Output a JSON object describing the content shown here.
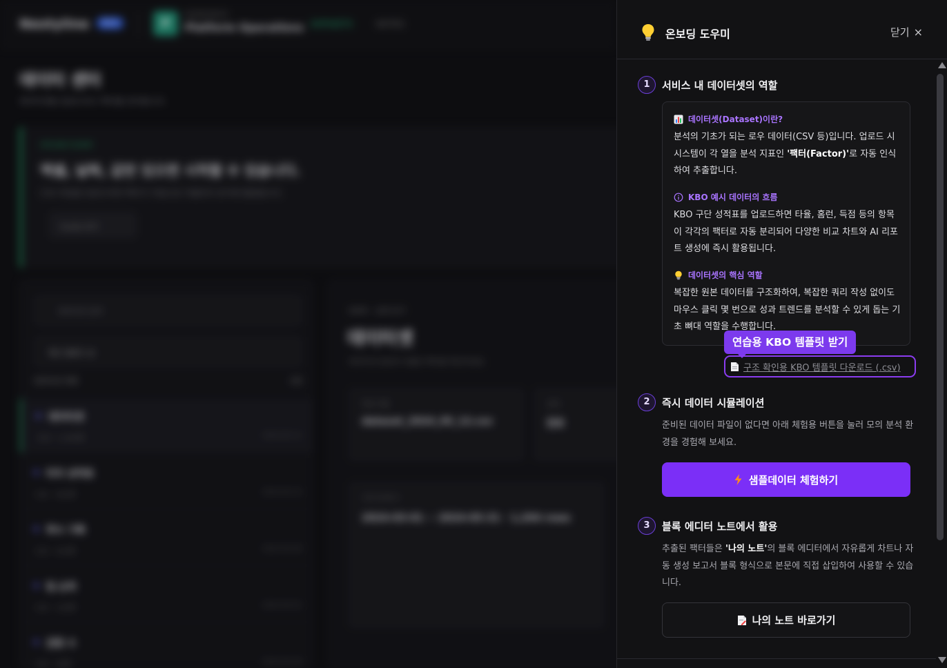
{
  "background": {
    "logo": "Nestyline",
    "beta": "Beta",
    "workspace_sub": "WORKSPACE",
    "workspace_name": "Platform Operations",
    "workspace_initial": "P",
    "nav_active": "DATASETS",
    "nav_other": "NOTES",
    "page_title": "데이터 센터",
    "page_subtitle": "데이터셋을 업로드하고 팩터를 관리합니다.",
    "banner_tag": "UPLOAD GUIDE",
    "banner_title": "엑셀, 날짜, 값만 있으면 시작할 수 있습니다.",
    "banner_desc": "CSV 파일을 업로드하면 팩터가 자동으로 추출되어 분석에 활용됩니다.",
    "banner_btn": "Guide 보기",
    "search_placeholder": "데이터셋 검색",
    "select_value": "최근 업로드 순",
    "list_head": "데이터셋 목록",
    "list_count": "4개",
    "items": [
      {
        "title": "데이터셋",
        "meta": "CSV · 1,204행",
        "date": "2024.05.12"
      },
      {
        "title": "타자 성적표",
        "meta": "CSV · 842행",
        "date": "2024.05.10"
      },
      {
        "title": "투수 기록",
        "meta": "CSV · 610행",
        "date": "2024.05.08"
      },
      {
        "title": "팀 순위",
        "meta": "CSV · 120행",
        "date": "2024.05.02"
      },
      {
        "title": "관중 수",
        "meta": "CSV · 96행",
        "date": "2024.04.28"
      }
    ],
    "detail_crumb": "DATA · 상세 보기",
    "detail_title": "데이터셋",
    "detail_sub": "데이터셋 정보와 추출된 팩터를 확인하세요.",
    "card1_label": "파일 이름",
    "card1_value": "dataset_2024_05_12.csv",
    "card2_label": "상태",
    "card2_value": "완료",
    "card3_label": "기간 및 행 수",
    "card3_value": "2024-03-01 ~ 2024-05-31 · 1,204 rows"
  },
  "panel": {
    "title": "온보딩 도우미",
    "close_label": "닫기",
    "icons": {
      "header": "lightbulb-icon",
      "chart": "bar-chart-icon",
      "info": "info-circle-icon",
      "tip": "lightbulb-icon",
      "file": "document-icon",
      "bolt": "lightning-icon",
      "note": "memo-icon",
      "close": "close-icon"
    },
    "step1": {
      "num": "1",
      "title": "서비스 내 데이터셋의 역할",
      "sec1_title": "데이터셋(Dataset)이란?",
      "sec1_body_a": "분석의 기초가 되는 로우 데이터(CSV 등)입니다. 업로드 시 시스템이 각 열을 분석 지표인 ",
      "sec1_body_b": "'팩터(Factor)'",
      "sec1_body_c": "로 자동 인식하여 추출합니다.",
      "sec2_title": "KBO 예시 데이터의 흐름",
      "sec2_body": "KBO 구단 성적표를 업로드하면 타율, 홈런, 득점 등의 항목이 각각의 팩터로 자동 분리되어 다양한 비교 차트와 AI 리포트 생성에 즉시 활용됩니다.",
      "sec3_title": "데이터셋의 핵심 역할",
      "sec3_body": "복잡한 원본 데이터를 구조화하여, 복잡한 쿼리 작성 없이도 마우스 클릭 몇 번으로 성과 트렌드를 분석할 수 있게 돕는 기초 뼈대 역할을 수행합니다.",
      "tooltip": "연습용 KBO 템플릿 받기",
      "download_link": "구조 확인용 KBO 템플릿 다운로드 (.csv)"
    },
    "step2": {
      "num": "2",
      "title": "즉시 데이터 시뮬레이션",
      "desc": "준비된 데이터 파일이 없다면 아래 체험용 버튼을 눌러 모의 분석 환경을 경험해 보세요.",
      "button": "샘플데이터 체험하기"
    },
    "step3": {
      "num": "3",
      "title": "블록 에디터 노트에서 활용",
      "desc_a": "추출된 팩터들은 ",
      "desc_b": "'나의 노트'",
      "desc_c": "의 블록 에디터에서 자유롭게 차트나 자동 생성 보고서 블록 형식으로 본문에 직접 삽입하여 사용할 수 있습니다.",
      "button": "나의 노트 바로가기"
    }
  }
}
